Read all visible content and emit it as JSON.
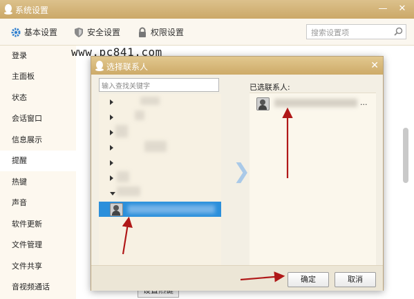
{
  "window": {
    "title": "系统设置"
  },
  "tabs": [
    {
      "label": "基本设置",
      "icon": "gear-icon",
      "active": true
    },
    {
      "label": "安全设置",
      "icon": "shield-icon",
      "active": false
    },
    {
      "label": "权限设置",
      "icon": "lock-icon",
      "active": false
    }
  ],
  "search": {
    "placeholder": "搜索设置项"
  },
  "sidebar": {
    "items": [
      {
        "label": "登录"
      },
      {
        "label": "主面板"
      },
      {
        "label": "状态"
      },
      {
        "label": "会话窗口"
      },
      {
        "label": "信息展示"
      },
      {
        "label": "提醒",
        "active": true
      },
      {
        "label": "热键"
      },
      {
        "label": "声音"
      },
      {
        "label": "软件更新"
      },
      {
        "label": "文件管理"
      },
      {
        "label": "文件共享"
      },
      {
        "label": "音视频通话"
      }
    ]
  },
  "watermark": "www.pc841.com",
  "background_button": "设置热键",
  "dialog": {
    "title": "选择联系人",
    "search_placeholder": "输入查找关键字",
    "selected_label": "已选联系人:",
    "selected_suffix": "...",
    "ok": "确定",
    "cancel": "取消"
  },
  "colors": {
    "accent": "#cba868",
    "selection": "#2b8fdb",
    "arrow": "#b01818"
  }
}
